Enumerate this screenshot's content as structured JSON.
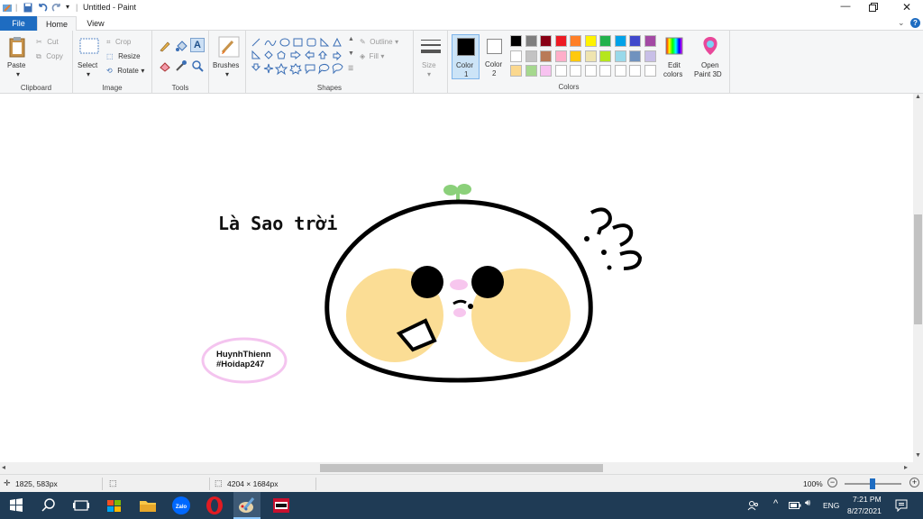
{
  "window": {
    "title": "Untitled - Paint"
  },
  "tabs": {
    "file": "File",
    "home": "Home",
    "view": "View"
  },
  "ribbon": {
    "clipboard": {
      "paste": "Paste",
      "cut": "Cut",
      "copy": "Copy",
      "label": "Clipboard"
    },
    "image": {
      "select": "Select",
      "crop": "Crop",
      "resize": "Resize",
      "rotate": "Rotate",
      "label": "Image"
    },
    "tools": {
      "label": "Tools"
    },
    "brushes": {
      "label": "Brushes"
    },
    "shapes": {
      "outline": "Outline",
      "fill": "Fill",
      "label": "Shapes"
    },
    "size": {
      "label": "Size"
    },
    "color1": {
      "label": "Color",
      "num": "1",
      "value": "#000000"
    },
    "color2": {
      "label": "Color",
      "num": "2",
      "value": "#ffffff"
    },
    "colors": {
      "label": "Colors",
      "row1": [
        "#000000",
        "#7f7f7f",
        "#880015",
        "#ed1c24",
        "#ff7f27",
        "#fff200",
        "#22b14c",
        "#00a2e8",
        "#3f48cc",
        "#a349a4"
      ],
      "row2": [
        "#ffffff",
        "#c3c3c3",
        "#b97a57",
        "#ffaec9",
        "#ffc90e",
        "#efe4b0",
        "#b5e61d",
        "#99d9ea",
        "#7092be",
        "#c8bfe7"
      ],
      "row3": [
        "#fbd88e",
        "#a5d88e",
        "#f8c2f0",
        "#ffffff",
        "#ffffff",
        "#ffffff",
        "#ffffff",
        "#ffffff",
        "#ffffff",
        "#ffffff"
      ]
    },
    "edit_colors": {
      "line1": "Edit",
      "line2": "colors"
    },
    "paint3d": {
      "line1": "Open",
      "line2": "Paint 3D"
    }
  },
  "canvas": {
    "text": "Là Sao trời",
    "signature_line1": "HuynhThienn",
    "signature_line2": "#Hoidap247"
  },
  "status": {
    "cursor": "1825, 583px",
    "size": "4204 × 1684px",
    "zoom": "100%"
  },
  "taskbar": {
    "lang": "ENG",
    "time": "7:21 PM",
    "date": "8/27/2021"
  }
}
